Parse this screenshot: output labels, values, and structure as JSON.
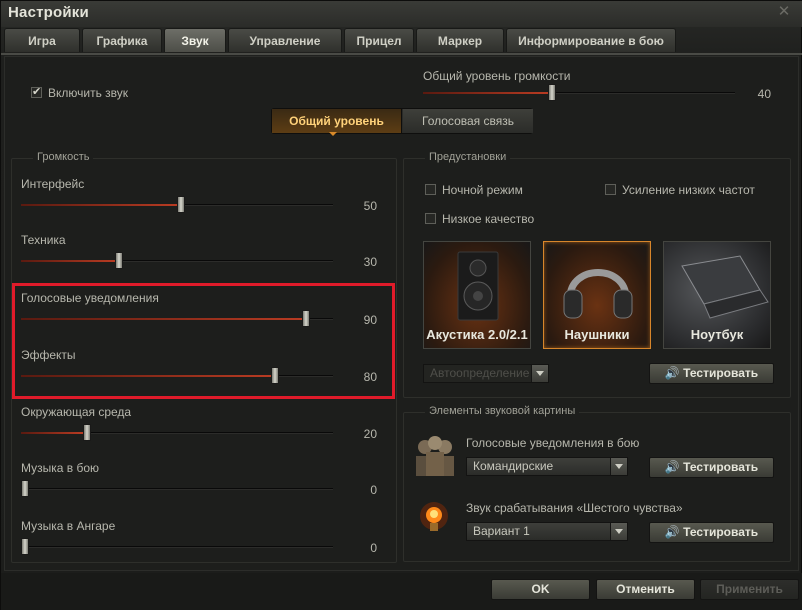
{
  "window": {
    "title": "Настройки"
  },
  "tabs": [
    {
      "label": "Игра",
      "active": false
    },
    {
      "label": "Графика",
      "active": false
    },
    {
      "label": "Звук",
      "active": true
    },
    {
      "label": "Управление",
      "active": false
    },
    {
      "label": "Прицел",
      "active": false
    },
    {
      "label": "Маркер",
      "active": false
    },
    {
      "label": "Информирование в бою",
      "active": false
    }
  ],
  "enable_sound": {
    "label": "Включить звук",
    "checked": true
  },
  "master_volume": {
    "label": "Общий уровень громкости",
    "value": 40
  },
  "mode_switch": {
    "active": "Общий уровень",
    "inactive": "Голосовая связь"
  },
  "volume_group": {
    "title": "Громкость",
    "sliders": [
      {
        "label": "Интерфейс",
        "value": 50
      },
      {
        "label": "Техника",
        "value": 30
      },
      {
        "label": "Голосовые уведомления",
        "value": 90
      },
      {
        "label": "Эффекты",
        "value": 80
      },
      {
        "label": "Окружающая среда",
        "value": 20
      },
      {
        "label": "Музыка в бою",
        "value": 0
      },
      {
        "label": "Музыка в Ангаре",
        "value": 0
      }
    ]
  },
  "presets": {
    "title": "Предустановки",
    "night_mode": {
      "label": "Ночной режим",
      "checked": false
    },
    "bass_boost": {
      "label": "Усиление низких частот",
      "checked": false
    },
    "low_quality": {
      "label": "Низкое качество",
      "checked": false
    },
    "devices": [
      {
        "label": "Акустика 2.0/2.1",
        "selected": false,
        "icon": "speaker-icon"
      },
      {
        "label": "Наушники",
        "selected": true,
        "icon": "headphones-icon"
      },
      {
        "label": "Ноутбук",
        "selected": false,
        "icon": "laptop-icon"
      }
    ],
    "autodetect": "Автоопределение",
    "test_label": "Тестировать"
  },
  "sound_elements": {
    "title": "Элементы звуковой картины",
    "voice": {
      "label": "Голосовые уведомления в бою",
      "value": "Командирские",
      "test_label": "Тестировать"
    },
    "sixth_sense": {
      "label": "Звук срабатывания «Шестого чувства»",
      "value": "Вариант 1",
      "test_label": "Тестировать"
    }
  },
  "footer": {
    "ok": "OK",
    "cancel": "Отменить",
    "apply": "Применить"
  },
  "colors": {
    "accent": "#d7862b",
    "highlight": "#e01b2a",
    "fill": "#b83b22"
  }
}
